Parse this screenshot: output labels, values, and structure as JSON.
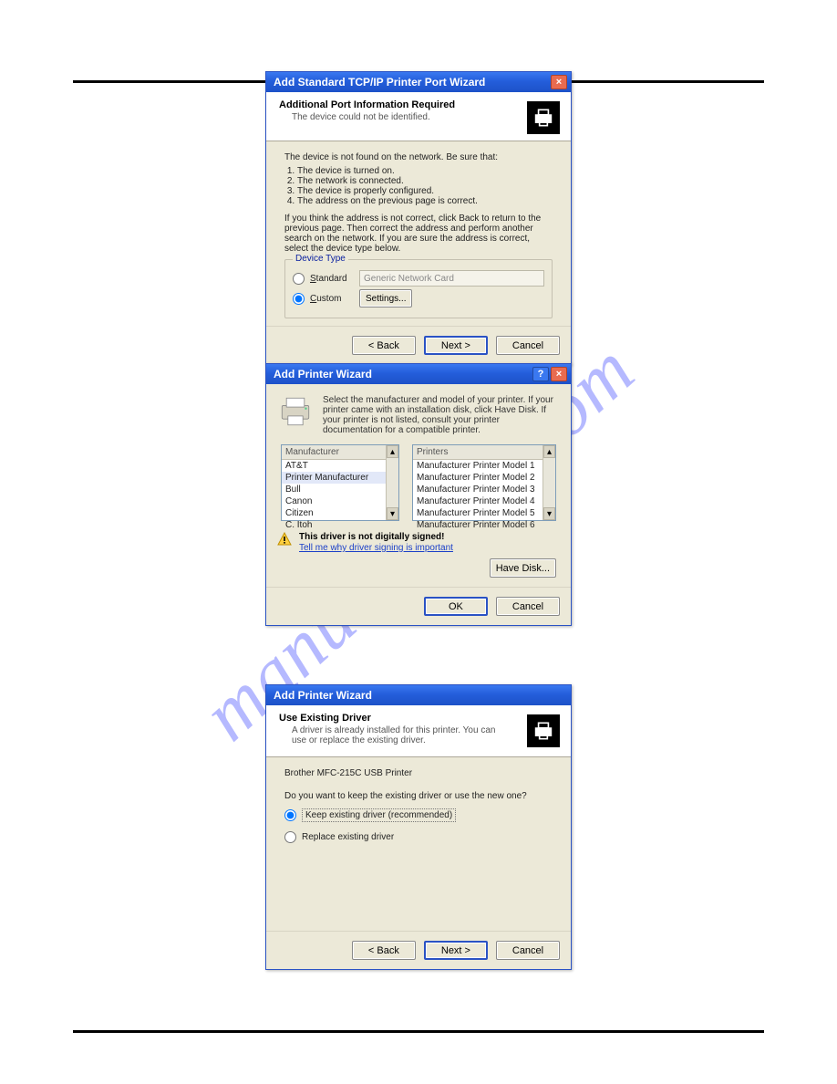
{
  "watermark": "manualshive.com",
  "dialog1": {
    "title": "Add Standard TCP/IP Printer Port Wizard",
    "header_h1": "Additional Port Information Required",
    "header_h2": "The device could not be identified.",
    "line_notfound": "The device is not found on the network.  Be sure that:",
    "steps": [
      "The device is turned on.",
      "The network is connected.",
      "The device is properly configured.",
      "The address on the previous page is correct."
    ],
    "line_note": "If you think the address is not correct, click Back to return to the previous page. Then correct the address and perform another search on the network. If you are sure the address is correct, select the device type below.",
    "group_legend": "Device Type",
    "radio_standard": "Standard",
    "combo_value": "Generic Network Card",
    "radio_custom": "Custom",
    "settings_btn": "Settings...",
    "btn_back": "< Back",
    "btn_next": "Next >",
    "btn_cancel": "Cancel"
  },
  "dialog2": {
    "title": "Add Printer Wizard",
    "desc": "Select the manufacturer and model of your printer. If your printer came with an installation disk, click Have Disk. If your printer is not listed, consult your printer documentation for a compatible printer.",
    "mfr_header": "Manufacturer",
    "manufacturers": [
      "AT&T",
      "Printer Manufacturer",
      "Bull",
      "Canon",
      "Citizen",
      "C. Itoh"
    ],
    "prn_header": "Printers",
    "printers": [
      "Manufacturer Printer Model 1",
      "Manufacturer Printer Model 2",
      "Manufacturer Printer Model 3",
      "Manufacturer Printer Model 4",
      "Manufacturer Printer Model 5",
      "Manufacturer Printer Model 6"
    ],
    "sign_bold": "This driver is not digitally signed!",
    "sign_link": "Tell me why driver signing is important",
    "btn_have_disk": "Have Disk...",
    "btn_ok": "OK",
    "btn_cancel": "Cancel"
  },
  "dialog3": {
    "title": "Add Printer Wizard",
    "header_h1": "Use Existing Driver",
    "header_h2": "A driver is already installed for this printer. You can use or replace the existing driver.",
    "printer_name": "Brother MFC-215C USB Printer",
    "question": "Do you want to keep the existing driver or use the new one?",
    "radio_keep": "Keep existing driver (recommended)",
    "radio_replace": "Replace existing driver",
    "btn_back": "< Back",
    "btn_next": "Next >",
    "btn_cancel": "Cancel"
  }
}
